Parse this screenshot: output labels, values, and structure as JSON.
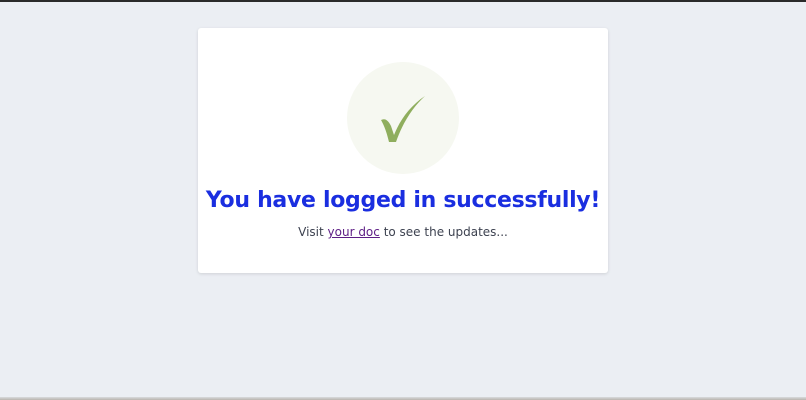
{
  "colors": {
    "page_background": "#ebeef3",
    "card_background": "#ffffff",
    "title": "#1a2ee0",
    "check": "#8fae5e",
    "check_circle": "#f6f8f1",
    "link": "#5d1d85"
  },
  "success_card": {
    "icon": "checkmark-icon",
    "title": "You have logged in successfully!",
    "message": {
      "prefix": "Visit ",
      "link_label": "your doc",
      "suffix": " to see the updates..."
    }
  }
}
